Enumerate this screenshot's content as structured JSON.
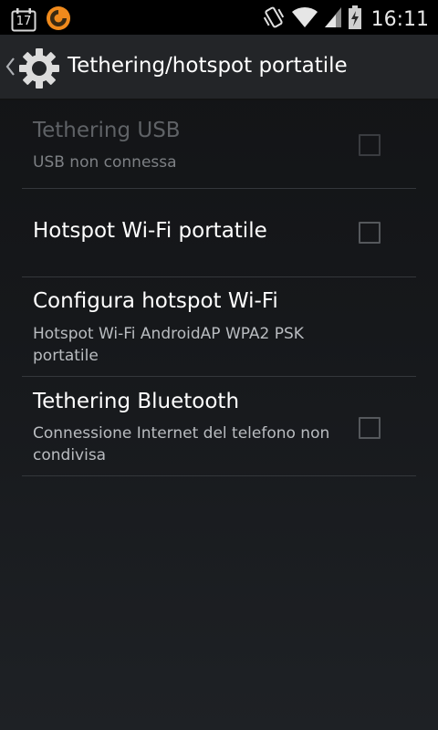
{
  "status_bar": {
    "calendar_day": "17",
    "clock": "16:11",
    "icons": [
      "calendar-icon",
      "app-notification-icon",
      "vibrate-icon",
      "wifi-icon",
      "cell-signal-icon",
      "battery-charging-icon"
    ]
  },
  "action_bar": {
    "title": "Tethering/hotspot portatile",
    "icons": [
      "back-chevron-icon",
      "settings-gear-icon"
    ]
  },
  "settings": [
    {
      "title": "Tethering USB",
      "summary": "USB non connessa",
      "checkbox": true,
      "checked": false,
      "enabled": false
    },
    {
      "title": "Hotspot Wi-Fi portatile",
      "summary": "",
      "checkbox": true,
      "checked": false,
      "enabled": true
    },
    {
      "title": "Configura hotspot Wi-Fi",
      "summary": "Hotspot Wi-Fi AndroidAP WPA2 PSK portatile",
      "checkbox": false,
      "enabled": true
    },
    {
      "title": "Tethering Bluetooth",
      "summary": "Connessione Internet del telefono non condivisa",
      "checkbox": true,
      "checked": false,
      "enabled": true
    }
  ],
  "colors": {
    "background": "#16181b",
    "action_bar": "#232528",
    "divider": "#34373b",
    "notification_orange": "#f08a1c"
  }
}
